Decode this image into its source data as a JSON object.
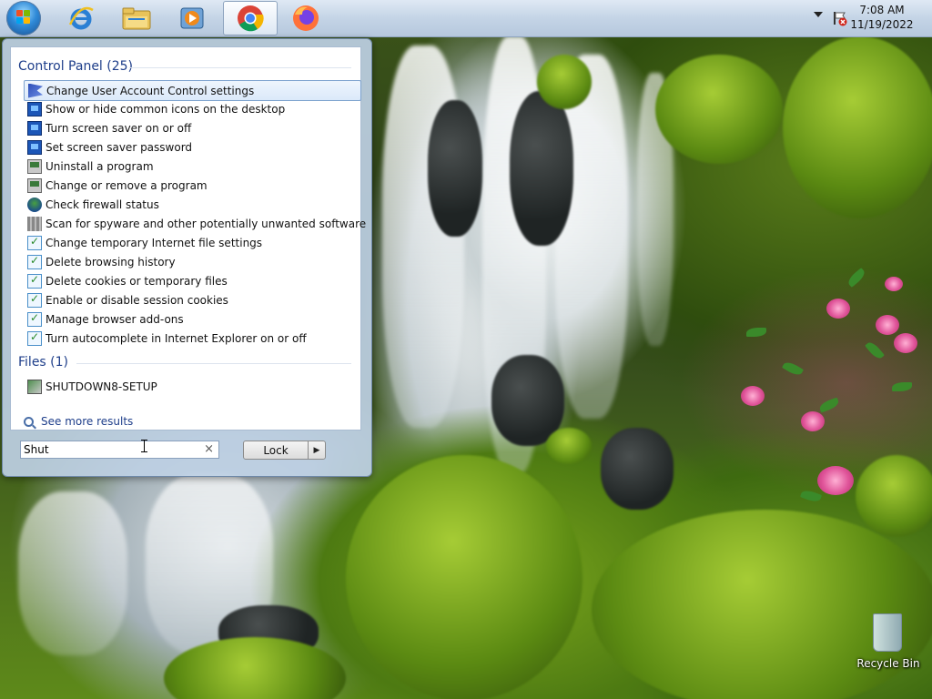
{
  "taskbar": {
    "pinned": [
      {
        "name": "Internet Explorer",
        "icon": "internet-explorer-icon"
      },
      {
        "name": "Windows Explorer",
        "icon": "folder-icon"
      },
      {
        "name": "Windows Media Player",
        "icon": "media-player-icon"
      },
      {
        "name": "Google Chrome",
        "icon": "chrome-icon",
        "active": true
      },
      {
        "name": "Firefox",
        "icon": "firefox-icon"
      }
    ],
    "clock": {
      "time": "7:08 AM",
      "date": "11/19/2022"
    }
  },
  "start_menu": {
    "groups": [
      {
        "header": "Control Panel (25)",
        "items": [
          {
            "label": "Change User Account Control settings",
            "icon": "uac-flag-icon",
            "selected": true
          },
          {
            "label": "Show or hide common icons on the desktop",
            "icon": "display-icon"
          },
          {
            "label": "Turn screen saver on or off",
            "icon": "display-icon"
          },
          {
            "label": "Set screen saver password",
            "icon": "display-icon"
          },
          {
            "label": "Uninstall a program",
            "icon": "programs-icon"
          },
          {
            "label": "Change or remove a program",
            "icon": "programs-icon"
          },
          {
            "label": "Check firewall status",
            "icon": "firewall-icon"
          },
          {
            "label": "Scan for spyware and other potentially unwanted software",
            "icon": "defender-icon"
          },
          {
            "label": "Change temporary Internet file settings",
            "icon": "internet-options-icon"
          },
          {
            "label": "Delete browsing history",
            "icon": "internet-options-icon"
          },
          {
            "label": "Delete cookies or temporary files",
            "icon": "internet-options-icon"
          },
          {
            "label": "Enable or disable session cookies",
            "icon": "internet-options-icon"
          },
          {
            "label": "Manage browser add-ons",
            "icon": "internet-options-icon"
          },
          {
            "label": "Turn autocomplete in Internet Explorer on or off",
            "icon": "internet-options-icon"
          }
        ]
      },
      {
        "header": "Files (1)",
        "items": [
          {
            "label": "SHUTDOWN8-SETUP",
            "icon": "setup-icon"
          }
        ]
      }
    ],
    "see_more": "See more results",
    "search": {
      "value": "Shut",
      "clear_glyph": "×"
    },
    "power": {
      "label": "Lock",
      "arrow": "▶"
    }
  },
  "desktop": {
    "recycle_bin_label": "Recycle Bin"
  }
}
